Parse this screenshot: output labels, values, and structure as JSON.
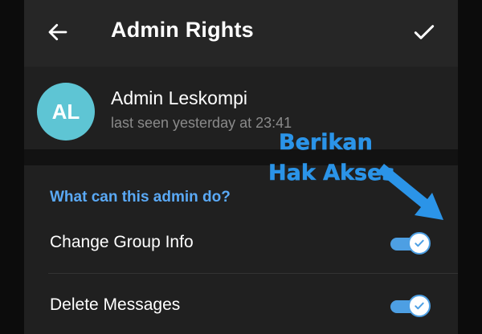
{
  "header": {
    "title": "Admin Rights",
    "back_icon": "arrow-left-icon",
    "confirm_icon": "checkmark-icon"
  },
  "user": {
    "avatar_initials": "AL",
    "avatar_color": "#5ec5d4",
    "name": "Admin Leskompi",
    "status": "last seen yesterday at 23:41"
  },
  "permissions": {
    "section_title": "What can this admin do?",
    "items": [
      {
        "label": "Change Group Info",
        "enabled": true
      },
      {
        "label": "Delete Messages",
        "enabled": true
      }
    ]
  },
  "annotation": {
    "line1": "Berikan",
    "line2": "Hak Akses",
    "color": "#2b94e8"
  },
  "colors": {
    "accent": "#5aa9f5",
    "toggle_on": "#4d9fe3",
    "background": "#202020"
  }
}
